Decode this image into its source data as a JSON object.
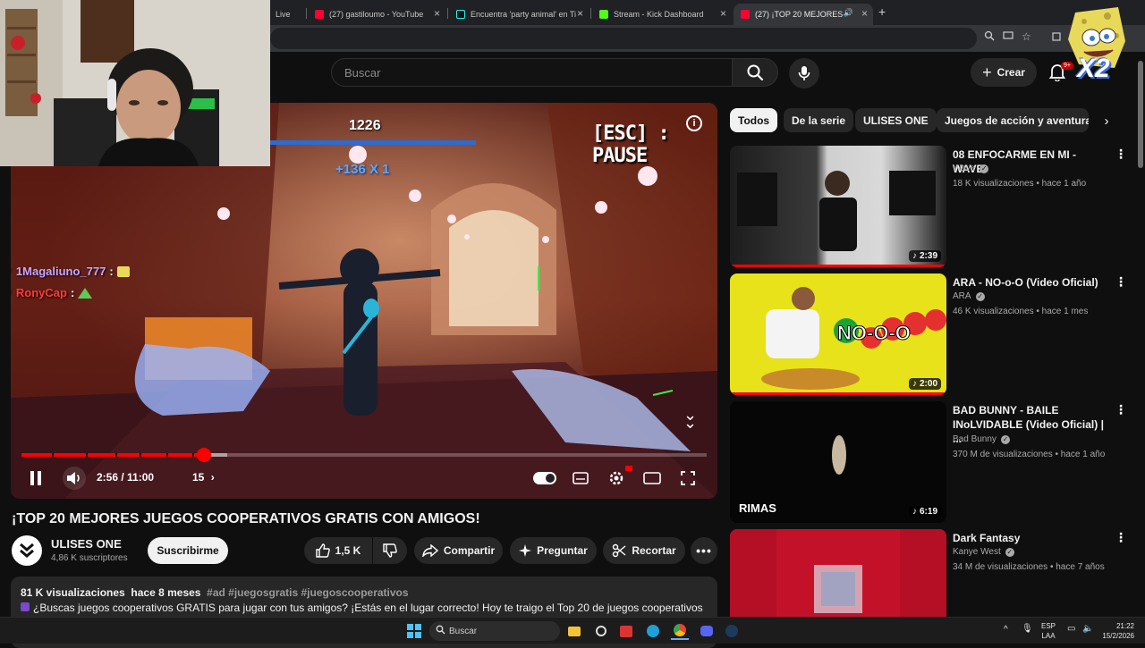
{
  "browser": {
    "tabs": [
      {
        "label": "Live"
      },
      {
        "label": "(27) gastiloumo - YouTube"
      },
      {
        "label": "Encuentra 'party animal' en Tik"
      },
      {
        "label": "Stream - Kick Dashboard"
      },
      {
        "label": "(27) ¡TOP 20 MEJORES JUE"
      }
    ],
    "new_tab": "+"
  },
  "header": {
    "search_placeholder": "Buscar",
    "create_label": "Crear",
    "notification_count": "9+"
  },
  "overlay": {
    "multiplier_text": "X2"
  },
  "player": {
    "score": "1226",
    "combo": "+136 X 1",
    "pause_hint": "[ESC] : PAUSE",
    "chat": [
      {
        "user": "1Magaliuno_777",
        "sep": ":"
      },
      {
        "user": "RonyCap",
        "sep": ":"
      }
    ],
    "time": "2:56 / 11:00",
    "chapter": "15",
    "progress": 0.266,
    "buffered": 0.3,
    "colors": {
      "progress": "#ff0000",
      "chat_user1": "#c9a6ff",
      "chat_user2": "#ff3b3b"
    }
  },
  "video": {
    "title": "¡TOP 20 MEJORES JUEGOS COOPERATIVOS GRATIS CON AMIGOS!",
    "channel": "ULISES ONE",
    "subscribers": "4,86 K suscriptores",
    "subscribe_label": "Suscribirme",
    "likes": "1,5 K",
    "share_label": "Compartir",
    "ask_label": "Preguntar",
    "clip_label": "Recortar",
    "views": "81 K visualizaciones",
    "age": "hace 8 meses",
    "tags": "#ad #juegosgratis #juegoscooperativos",
    "description": "¿Buscas juegos cooperativos GRATIS para jugar con tus amigos? ¡Estás en el lugar correcto! Hoy te traigo el Top 20 de juegos cooperativos"
  },
  "chips": [
    {
      "label": "Todos",
      "selected": true
    },
    {
      "label": "De la serie",
      "selected": false
    },
    {
      "label": "ULISES ONE",
      "selected": false
    },
    {
      "label": "Juegos de acción y aventuras",
      "selected": false
    }
  ],
  "recommendations": [
    {
      "title": "08 ENFOCARME EN MI - WAVE",
      "channel": "Wave",
      "meta": "18 K visualizaciones • hace 1 año",
      "duration": "2:39",
      "thumb_text": ""
    },
    {
      "title": "ARA - NO-o-O (Video Oficial)",
      "channel": "ARA",
      "meta": "46 K visualizaciones • hace 1 mes",
      "duration": "2:00",
      "thumb_text": "NO-O-O"
    },
    {
      "title": "BAD BUNNY - BAILE INoLVIDABLE (Video Oficial) | ...",
      "channel": "Bad Bunny",
      "meta": "370 M de visualizaciones • hace 1 año",
      "duration": "6:19",
      "thumb_text": "RIMAS"
    },
    {
      "title": "Dark Fantasy",
      "channel": "Kanye West",
      "meta": "34 M de visualizaciones • hace 7 años",
      "duration": "",
      "thumb_text": ""
    }
  ],
  "taskbar": {
    "search_label": "Buscar",
    "lang_top": "ESP",
    "lang_bottom": "LAA",
    "time": "21:22",
    "date": "15/2/2026"
  }
}
